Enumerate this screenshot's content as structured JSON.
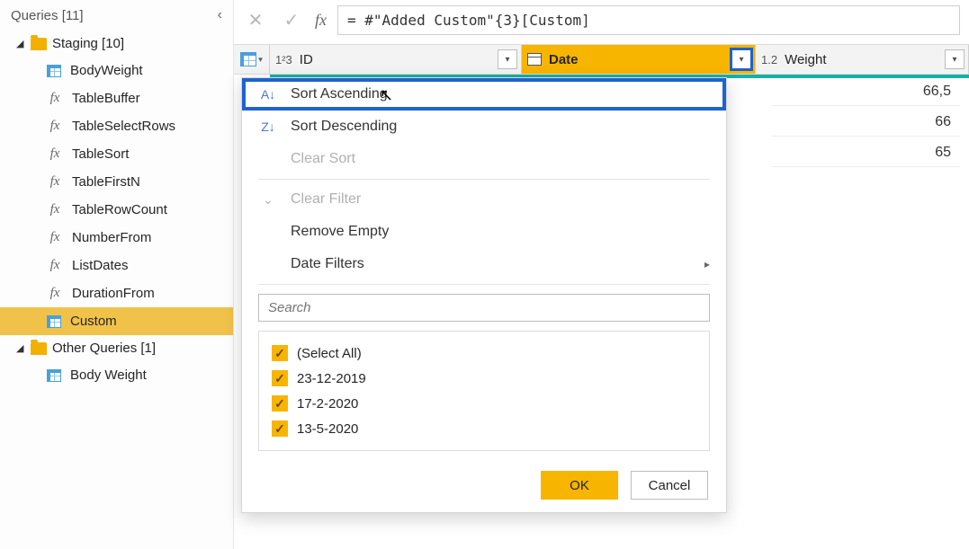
{
  "sidebar": {
    "title": "Queries [11]",
    "groups": [
      {
        "label": "Staging [10]"
      },
      {
        "label": "Other Queries [1]"
      }
    ],
    "staging_items": [
      {
        "label": "BodyWeight",
        "kind": "table"
      },
      {
        "label": "TableBuffer",
        "kind": "fx"
      },
      {
        "label": "TableSelectRows",
        "kind": "fx"
      },
      {
        "label": "TableSort",
        "kind": "fx"
      },
      {
        "label": "TableFirstN",
        "kind": "fx"
      },
      {
        "label": "TableRowCount",
        "kind": "fx"
      },
      {
        "label": "NumberFrom",
        "kind": "fx"
      },
      {
        "label": "ListDates",
        "kind": "fx"
      },
      {
        "label": "DurationFrom",
        "kind": "fx"
      },
      {
        "label": "Custom",
        "kind": "table",
        "selected": true
      }
    ],
    "other_items": [
      {
        "label": "Body Weight",
        "kind": "table"
      }
    ]
  },
  "formula": {
    "text": "= #\"Added Custom\"{3}[Custom]"
  },
  "grid": {
    "columns": {
      "id": {
        "type_label": "1²3",
        "label": "ID"
      },
      "date": {
        "label": "Date"
      },
      "weight": {
        "type_label": "1.2",
        "label": "Weight"
      }
    },
    "weight_values": [
      "66,5",
      "66",
      "65"
    ]
  },
  "menu": {
    "sort_asc": "Sort Ascending",
    "sort_desc": "Sort Descending",
    "clear_sort": "Clear Sort",
    "clear_filter": "Clear Filter",
    "remove_empty": "Remove Empty",
    "date_filters": "Date Filters",
    "search_placeholder": "Search",
    "options": [
      "(Select All)",
      "23-12-2019",
      "17-2-2020",
      "13-5-2020"
    ],
    "ok": "OK",
    "cancel": "Cancel"
  }
}
